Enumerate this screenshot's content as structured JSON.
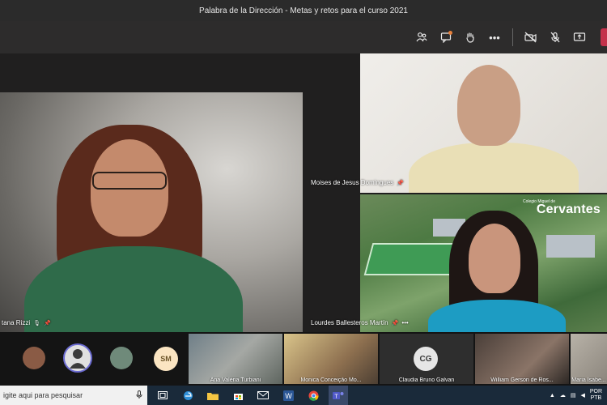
{
  "window": {
    "title": "Palabra de la Dirección - Metas y retos para el curso 2021"
  },
  "toolbar": {
    "icons": [
      "participants-icon",
      "chat-icon",
      "raise-hand-icon",
      "more-icon",
      "camera-off-icon",
      "mic-off-icon",
      "share-screen-icon"
    ],
    "more_label": "•••",
    "colors": {
      "notify": "#e6803c",
      "leave": "#c4314b"
    }
  },
  "videos": {
    "main": {
      "name": "tana Rizzi"
    },
    "moises": {
      "name": "Moises de Jesus Domingues"
    },
    "lourdes": {
      "name": "Lourdes Ballesteros Martín",
      "more_label": "•••",
      "brand": "Cervantes",
      "brand_small": "Colegio Miguel de"
    }
  },
  "strip": {
    "avatar_initials": "SM",
    "thumbnails": [
      {
        "name": "Ana Valéria Turbiani"
      },
      {
        "name": "Monica Conceição Mo..."
      },
      {
        "name": "Claudia Bruno Galvan",
        "initials": "CG"
      },
      {
        "name": "William Gerson de Ros..."
      },
      {
        "name": "Maria Isabe..."
      }
    ]
  },
  "taskbar": {
    "search_placeholder": "igite aqui para pesquisar",
    "lang_top": "POR",
    "lang_bottom": "PTB"
  }
}
